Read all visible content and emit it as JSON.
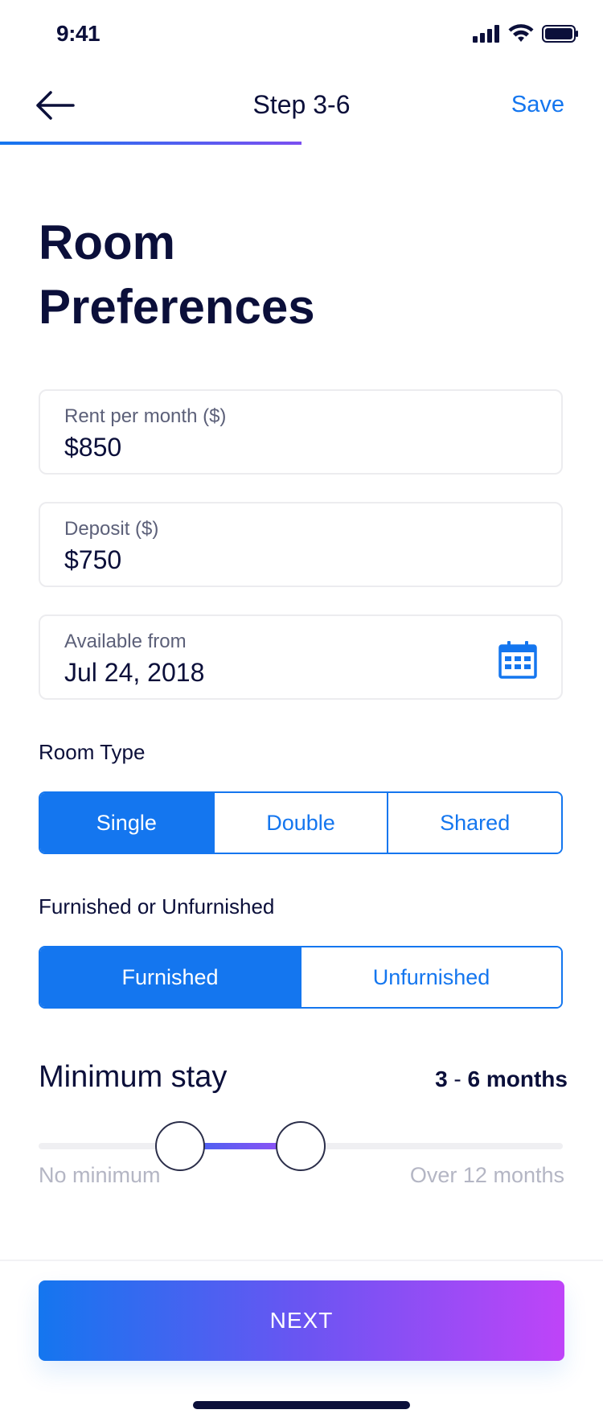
{
  "status_bar": {
    "time": "9:41"
  },
  "nav": {
    "title": "Step 3-6",
    "save_label": "Save",
    "progress_fraction": 0.5
  },
  "page": {
    "title_line1": "Room",
    "title_line2": "Preferences"
  },
  "fields": {
    "rent": {
      "label": "Rent per month ($)",
      "value": "$850"
    },
    "deposit": {
      "label": "Deposit ($)",
      "value": "$750"
    },
    "available": {
      "label": "Available from",
      "value": "Jul 24, 2018"
    }
  },
  "room_type": {
    "label": "Room Type",
    "options": [
      "Single",
      "Double",
      "Shared"
    ],
    "selected": "Single"
  },
  "furnishing": {
    "label": "Furnished or Unfurnished",
    "options": [
      "Furnished",
      "Unfurnished"
    ],
    "selected": "Furnished"
  },
  "min_stay": {
    "label": "Minimum stay",
    "value_low": "3",
    "value_sep": " - ",
    "value_high": "6 months",
    "min_label": "No minimum",
    "max_label": "Over 12 months",
    "low_fraction": 0.27,
    "high_fraction": 0.5
  },
  "footer": {
    "next_label": "NEXT"
  },
  "colors": {
    "accent": "#1476ef",
    "gradient_end": "#bf44f8",
    "text_primary": "#0b0f3a"
  }
}
